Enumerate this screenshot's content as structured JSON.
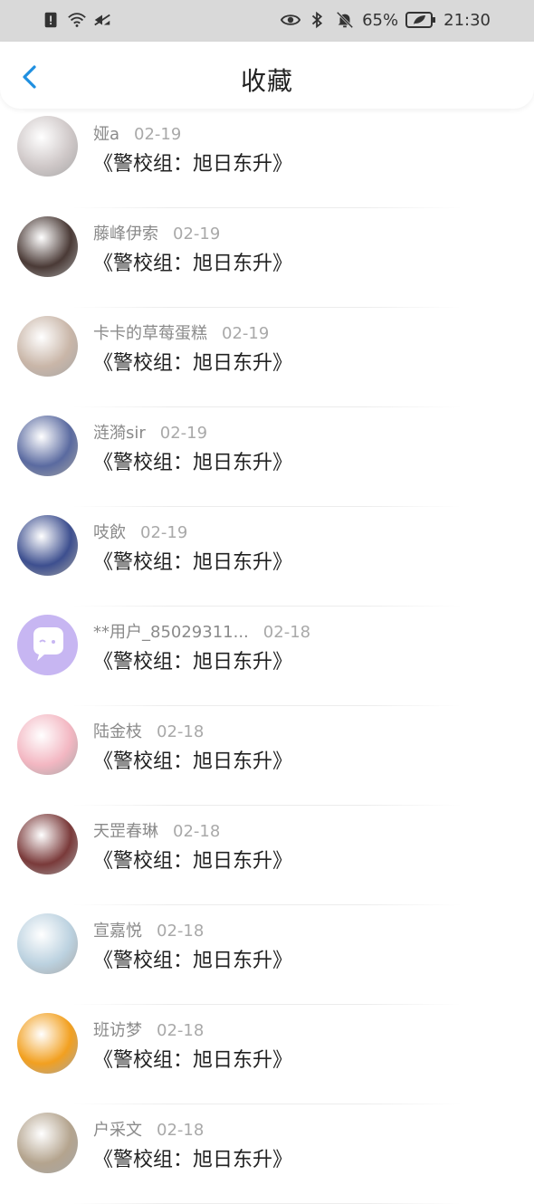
{
  "status_bar": {
    "battery_percent": "65%",
    "time": "21:30",
    "icons": [
      "alert-icon",
      "wifi-icon",
      "signal-icon",
      "eye-icon",
      "bluetooth-icon",
      "mute-icon",
      "battery-icon"
    ]
  },
  "header": {
    "title": "收藏",
    "back_icon": "chevron-left-icon"
  },
  "items": [
    {
      "name": "娅a",
      "date": "02-19",
      "title": "《警校组：旭日东升》",
      "avatar_color": "#cfc8c8"
    },
    {
      "name": "藤峰伊索",
      "date": "02-19",
      "title": "《警校组：旭日东升》",
      "avatar_color": "#4a3a36"
    },
    {
      "name": "卡卡的草莓蛋糕",
      "date": "02-19",
      "title": "《警校组：旭日东升》",
      "avatar_color": "#c9b6a8"
    },
    {
      "name": "涟漪sir",
      "date": "02-19",
      "title": "《警校组：旭日东升》",
      "avatar_color": "#5a6aa0"
    },
    {
      "name": "吱飲",
      "date": "02-19",
      "title": "《警校组：旭日东升》",
      "avatar_color": "#3d4f8f"
    },
    {
      "name": "**用户_85029311...",
      "date": "02-18",
      "title": "《警校组：旭日东升》",
      "avatar_color": "#c7b6f2"
    },
    {
      "name": "陆金枝",
      "date": "02-18",
      "title": "《警校组：旭日东升》",
      "avatar_color": "#f3b7c2"
    },
    {
      "name": "天罡春琳",
      "date": "02-18",
      "title": "《警校组：旭日东升》",
      "avatar_color": "#7a3a3a"
    },
    {
      "name": "宣嘉悦",
      "date": "02-18",
      "title": "《警校组：旭日东升》",
      "avatar_color": "#bcd2e0"
    },
    {
      "name": "班访梦",
      "date": "02-18",
      "title": "《警校组：旭日东升》",
      "avatar_color": "#f2a020"
    },
    {
      "name": "户采文",
      "date": "02-18",
      "title": "《警校组：旭日东升》",
      "avatar_color": "#b4a48e"
    }
  ]
}
